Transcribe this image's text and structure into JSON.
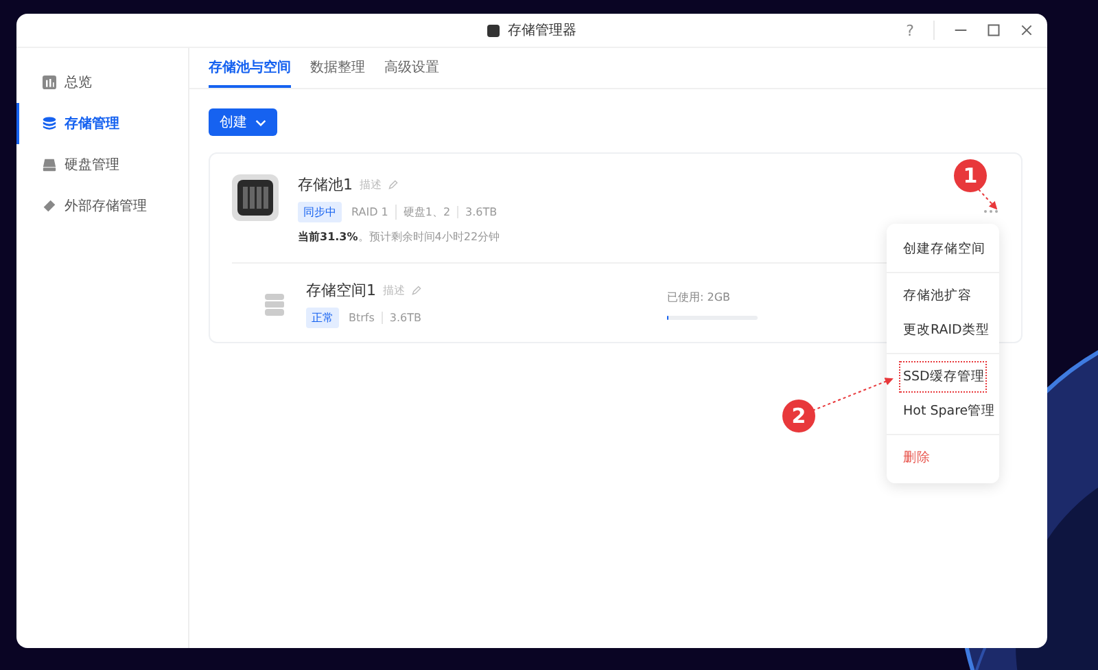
{
  "window": {
    "title": "存储管理器",
    "help": "?"
  },
  "sidebar": {
    "items": [
      {
        "label": "总览",
        "selected": false
      },
      {
        "label": "存储管理",
        "selected": true
      },
      {
        "label": "硬盘管理",
        "selected": false
      },
      {
        "label": "外部存储管理",
        "selected": false
      }
    ]
  },
  "tabs": [
    {
      "label": "存储池与空间",
      "selected": true
    },
    {
      "label": "数据整理",
      "selected": false
    },
    {
      "label": "高级设置",
      "selected": false
    }
  ],
  "create_button": {
    "label": "创建"
  },
  "pool": {
    "name": "存储池1",
    "description": "描述",
    "status": "同步中",
    "specs": [
      "RAID 1",
      "硬盘1、2",
      "3.6TB"
    ],
    "progress": "**当前31.3%**。预计剩余时间4小时22分钟"
  },
  "volume": {
    "name": "存储空间1",
    "description": "描述",
    "status": "正常",
    "specs": [
      "Btrfs",
      "3.6TB"
    ],
    "used": "已使用: 2GB",
    "level": 0.02
  },
  "menu": {
    "groups": [
      [
        {
          "label": "创建存储空间",
          "kind": "normal",
          "marked": false
        }
      ],
      [
        {
          "label": "存储池扩容",
          "kind": "normal",
          "marked": false
        },
        {
          "label": "更改RAID类型",
          "kind": "normal",
          "marked": false
        }
      ],
      [
        {
          "label": "SSD缓存管理",
          "kind": "normal",
          "marked": true
        },
        {
          "label": "Hot Spare管理",
          "kind": "normal",
          "marked": false
        }
      ],
      [
        {
          "label": "删除",
          "kind": "danger",
          "marked": false
        }
      ]
    ]
  },
  "annotations": [
    {
      "number": "1"
    },
    {
      "number": "2"
    }
  ]
}
